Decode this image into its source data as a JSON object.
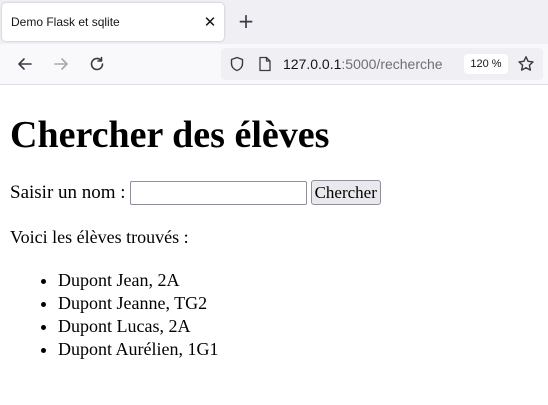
{
  "browser": {
    "tab_title": "Demo Flask et sqlite",
    "url_host": "127.0.0.1",
    "url_rest": ":5000/recherche",
    "zoom": "120 %"
  },
  "page": {
    "heading": "Chercher des élèves",
    "search_label": "Saisir un nom :",
    "search_value": "",
    "search_button": "Chercher",
    "results_label": "Voici les élèves trouvés :",
    "results": [
      "Dupont Jean, 2A",
      "Dupont Jeanne, TG2",
      "Dupont Lucas, 2A",
      "Dupont Aurélien, 1G1"
    ]
  }
}
